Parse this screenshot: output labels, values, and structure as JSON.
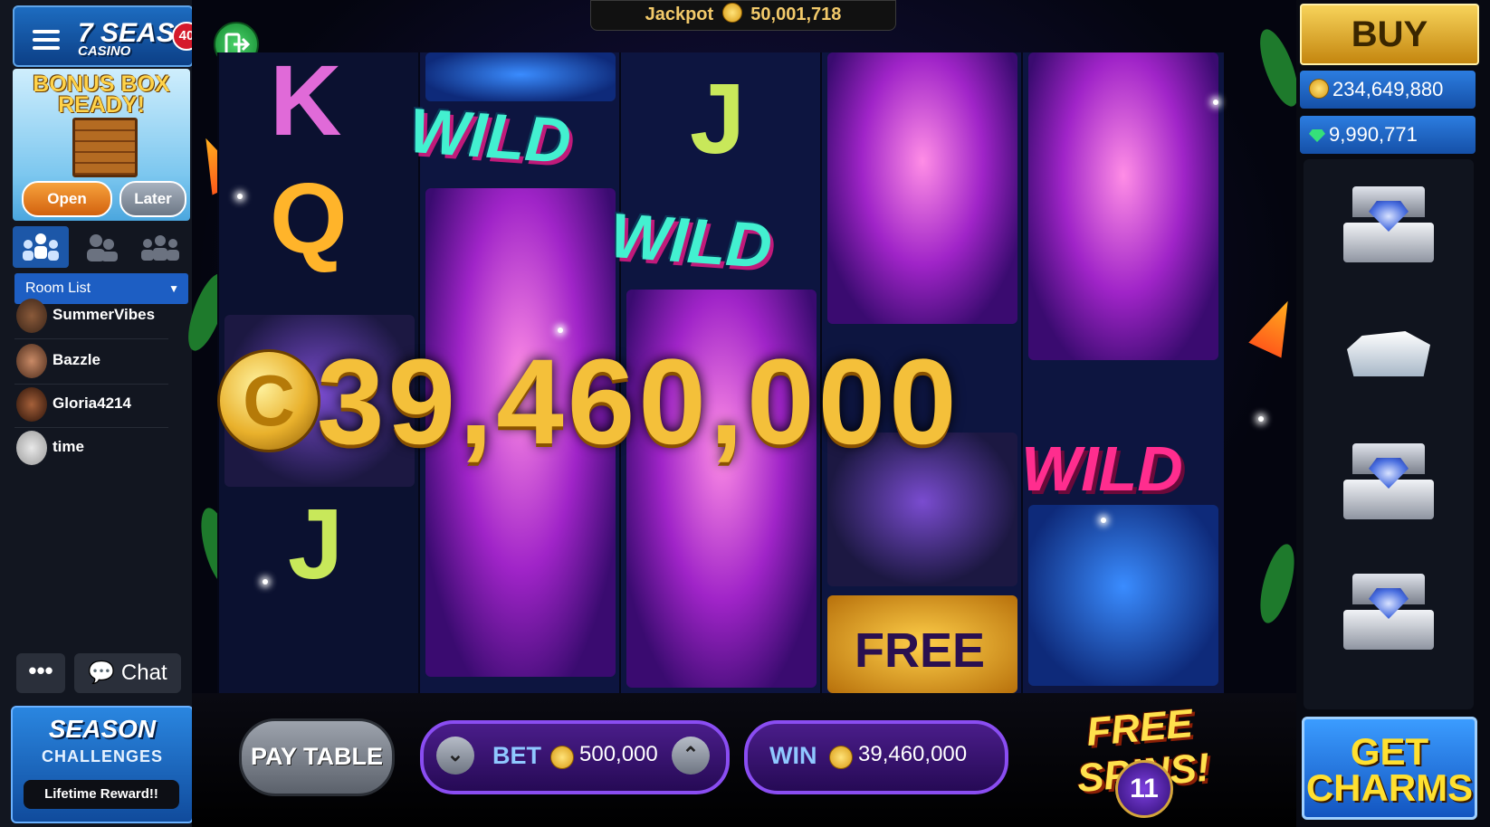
{
  "left_panel": {
    "logo": {
      "top_text": "7 SEAS",
      "sub_text": "CASINO"
    },
    "notification_count": "40",
    "bonus_box": {
      "title_line1": "BONUS BOX",
      "title_line2": "READY!",
      "open_label": "Open",
      "later_label": "Later"
    },
    "room_select": {
      "selected": "Room List"
    },
    "players": [
      {
        "name": "SummerVibes"
      },
      {
        "name": "Bazzle"
      },
      {
        "name": "Gloria4214"
      },
      {
        "name": "time"
      }
    ],
    "more_label": "•••",
    "chat_label": "Chat",
    "season": {
      "title": "SEASON",
      "subtitle": "CHALLENGES",
      "reward": "Lifetime Reward!!"
    }
  },
  "header": {
    "jackpot_label": "Jackpot",
    "jackpot_value": "50,001,718"
  },
  "reels": {
    "symbols": {
      "k": "K",
      "q": "Q",
      "j": "J",
      "wild": "WILD",
      "free_spins_symbol": "FREE"
    }
  },
  "win_display": {
    "amount": "39,460,000",
    "coin_letter": "C"
  },
  "bottom_bar": {
    "paytable_label": "PAY TABLE",
    "bet_label": "BET",
    "bet_value": "500,000",
    "win_label": "WIN",
    "win_value": "39,460,000",
    "free_spins_label": "FREE SPINS!",
    "free_spins_count": "11"
  },
  "right_panel": {
    "buy_label": "BUY",
    "coins_balance": "234,649,880",
    "gems_balance": "9,990,771",
    "get_charms_line1": "GET",
    "get_charms_line2": "CHARMS"
  },
  "colors": {
    "accent_blue": "#1d5ec3",
    "gold": "#f4c03a",
    "purple_frame": "#8a4df2",
    "wild_teal": "#43f0d0",
    "wild_pink": "#ff2d8e"
  }
}
